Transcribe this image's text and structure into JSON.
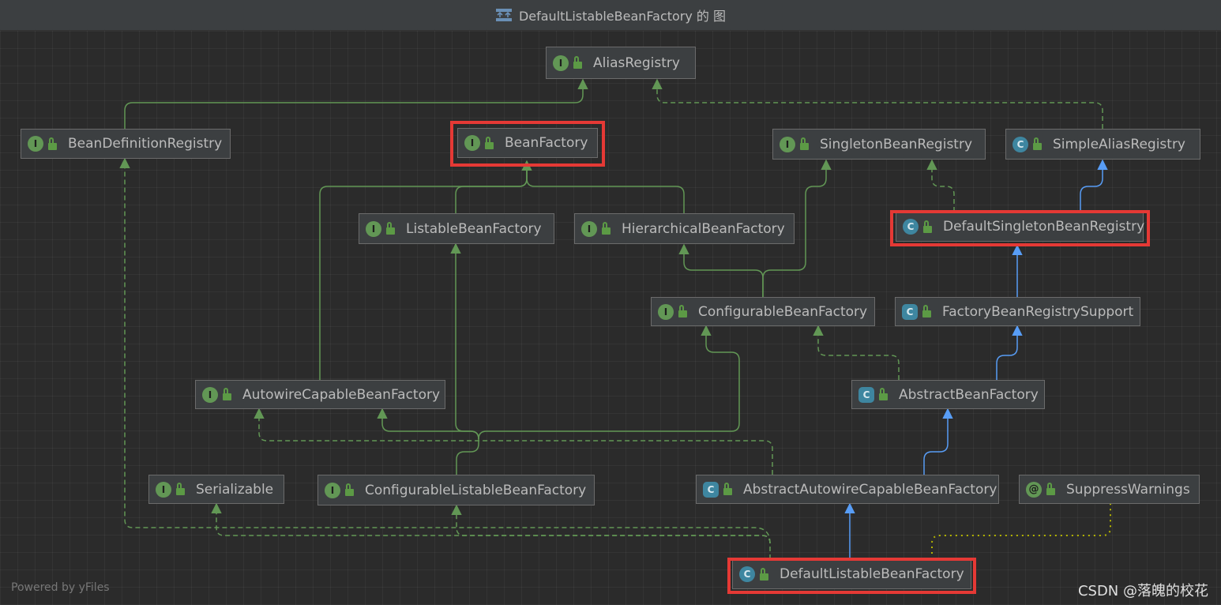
{
  "window": {
    "title": "DefaultListableBeanFactory 的 图"
  },
  "colors": {
    "background": "#2b2b2b",
    "node_fill": "#3c3f41",
    "node_border": "#6b6b6b",
    "interface_edge": "#629755",
    "class_edge": "#589df6",
    "highlight": "#e53935",
    "annotation_edge": "#b4b400"
  },
  "nodes": [
    {
      "id": "alias",
      "label": "AliasRegistry",
      "kind": "interface",
      "badge": "I"
    },
    {
      "id": "bdr",
      "label": "BeanDefinitionRegistry",
      "kind": "interface",
      "badge": "I"
    },
    {
      "id": "bf",
      "label": "BeanFactory",
      "kind": "interface",
      "badge": "I",
      "highlighted": true
    },
    {
      "id": "sbr",
      "label": "SingletonBeanRegistry",
      "kind": "interface",
      "badge": "I"
    },
    {
      "id": "sar",
      "label": "SimpleAliasRegistry",
      "kind": "class",
      "badge": "C"
    },
    {
      "id": "lbf",
      "label": "ListableBeanFactory",
      "kind": "interface",
      "badge": "I"
    },
    {
      "id": "hbf",
      "label": "HierarchicalBeanFactory",
      "kind": "interface",
      "badge": "I"
    },
    {
      "id": "dsbr",
      "label": "DefaultSingletonBeanRegistry",
      "kind": "class",
      "badge": "C",
      "highlighted": true
    },
    {
      "id": "cbf",
      "label": "ConfigurableBeanFactory",
      "kind": "interface",
      "badge": "I"
    },
    {
      "id": "fbrs",
      "label": "FactoryBeanRegistrySupport",
      "kind": "abstract",
      "badge": "C"
    },
    {
      "id": "acbf",
      "label": "AutowireCapableBeanFactory",
      "kind": "interface",
      "badge": "I"
    },
    {
      "id": "abf",
      "label": "AbstractBeanFactory",
      "kind": "abstract",
      "badge": "C"
    },
    {
      "id": "ser",
      "label": "Serializable",
      "kind": "interface",
      "badge": "I"
    },
    {
      "id": "clbf",
      "label": "ConfigurableListableBeanFactory",
      "kind": "interface",
      "badge": "I"
    },
    {
      "id": "aacbf",
      "label": "AbstractAutowireCapableBeanFactory",
      "kind": "abstract",
      "badge": "C"
    },
    {
      "id": "sw",
      "label": "SuppressWarnings",
      "kind": "annotation",
      "badge": "@"
    },
    {
      "id": "dlbf",
      "label": "DefaultListableBeanFactory",
      "kind": "class",
      "badge": "C",
      "highlighted": true
    }
  ],
  "edges": [
    {
      "from": "bdr",
      "to": "alias",
      "type": "extends"
    },
    {
      "from": "sar",
      "to": "alias",
      "type": "implements"
    },
    {
      "from": "dsbr",
      "to": "sar",
      "type": "class-extends"
    },
    {
      "from": "dsbr",
      "to": "sbr",
      "type": "implements"
    },
    {
      "from": "lbf",
      "to": "bf",
      "type": "extends"
    },
    {
      "from": "hbf",
      "to": "bf",
      "type": "extends"
    },
    {
      "from": "acbf",
      "to": "bf",
      "type": "extends"
    },
    {
      "from": "cbf",
      "to": "hbf",
      "type": "extends"
    },
    {
      "from": "cbf",
      "to": "sbr",
      "type": "extends"
    },
    {
      "from": "fbrs",
      "to": "dsbr",
      "type": "class-extends"
    },
    {
      "from": "abf",
      "to": "fbrs",
      "type": "class-extends"
    },
    {
      "from": "abf",
      "to": "cbf",
      "type": "implements"
    },
    {
      "from": "aacbf",
      "to": "abf",
      "type": "class-extends"
    },
    {
      "from": "aacbf",
      "to": "acbf",
      "type": "implements"
    },
    {
      "from": "clbf",
      "to": "lbf",
      "type": "extends"
    },
    {
      "from": "clbf",
      "to": "acbf",
      "type": "extends"
    },
    {
      "from": "clbf",
      "to": "cbf",
      "type": "extends"
    },
    {
      "from": "dlbf",
      "to": "aacbf",
      "type": "class-extends"
    },
    {
      "from": "dlbf",
      "to": "clbf",
      "type": "implements"
    },
    {
      "from": "dlbf",
      "to": "ser",
      "type": "implements"
    },
    {
      "from": "dlbf",
      "to": "bdr",
      "type": "implements"
    },
    {
      "from": "dlbf",
      "to": "sw",
      "type": "annotated"
    }
  ],
  "footer": {
    "powered_by": "Powered by yFiles"
  },
  "watermark": "CSDN @落魄的校花"
}
